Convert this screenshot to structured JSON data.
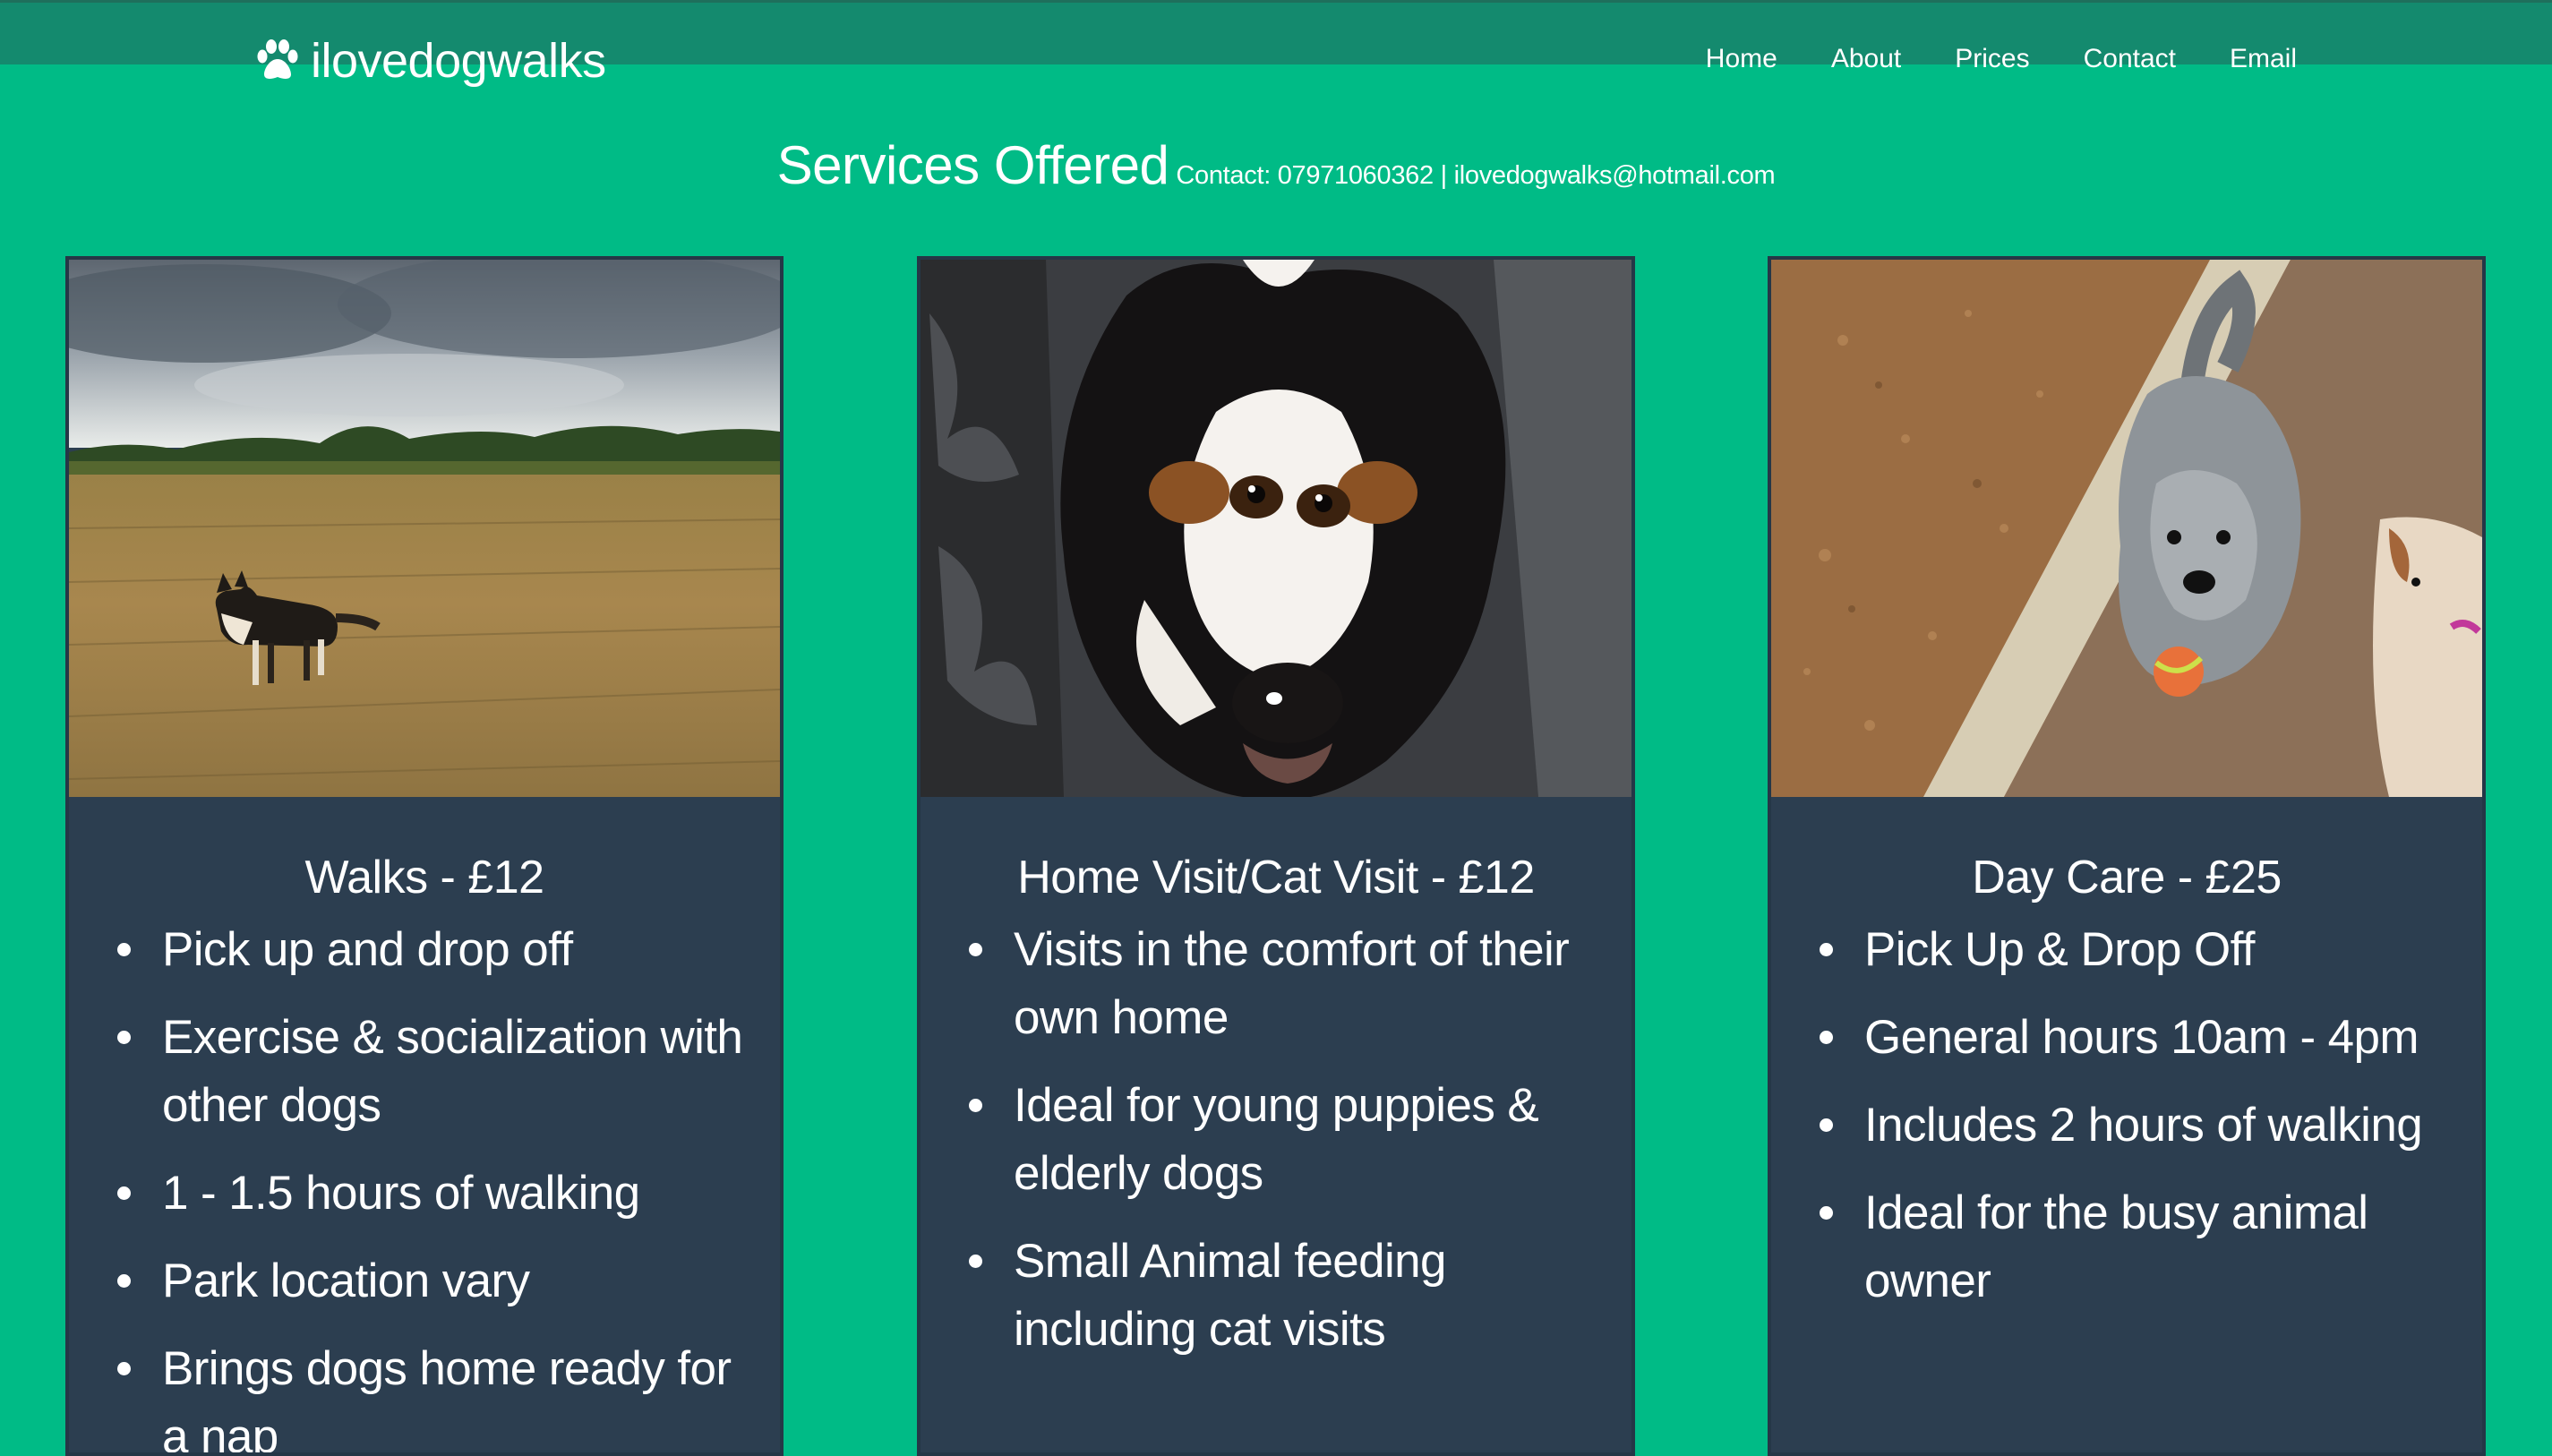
{
  "brand": {
    "name": "ilovedogwalks",
    "icon": "paw-icon"
  },
  "nav": {
    "items": [
      "Home",
      "About",
      "Prices",
      "Contact",
      "Email"
    ]
  },
  "heading": {
    "title": "Services Offered",
    "contact": "Contact: 07971060362 | ilovedogwalks@hotmail.com"
  },
  "colors": {
    "page_bg": "#00bb86",
    "navbar_bg": "#148a6e",
    "card_bg": "#2c3e50",
    "text": "#ffffff"
  },
  "services": [
    {
      "title": "Walks - £12",
      "photo": "dog-in-field-photo",
      "items": [
        "Pick up and drop off",
        "Exercise & socialization with other dogs",
        "1 - 1.5 hours of walking",
        "Park location vary",
        "Brings dogs home ready for a nap"
      ]
    },
    {
      "title": "Home Visit/Cat Visit - £12",
      "photo": "dog-closeup-photo",
      "items": [
        "Visits in the comfort of their own home",
        "Ideal for young puppies & elderly dogs",
        "Small Animal feeding including cat visits"
      ]
    },
    {
      "title": "Day Care - £25",
      "photo": "dogs-with-ball-photo",
      "items": [
        "Pick Up & Drop Off",
        "General hours 10am - 4pm",
        "Includes 2 hours of walking",
        "Ideal for the busy animal owner"
      ]
    }
  ]
}
